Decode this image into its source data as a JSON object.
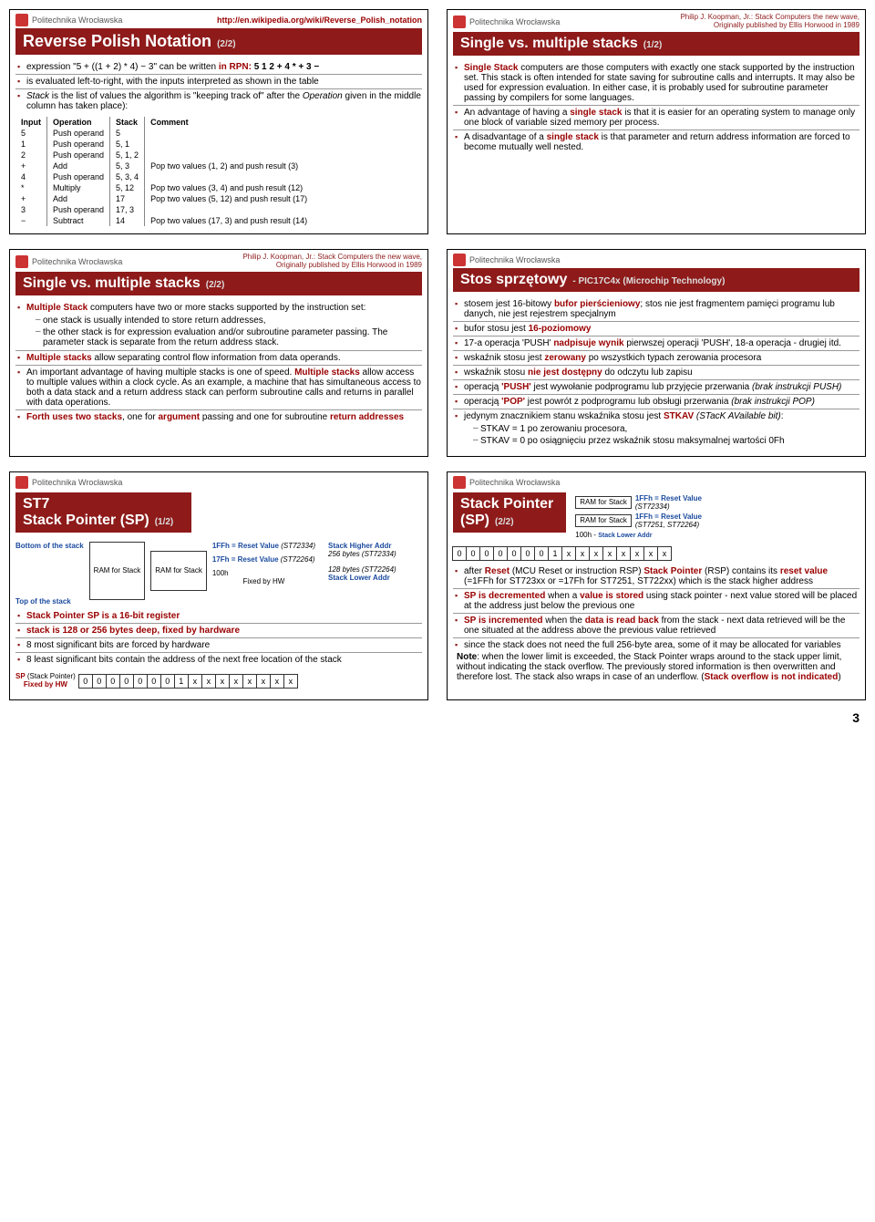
{
  "common": {
    "uni": "Politechnika Wrocławska"
  },
  "s1": {
    "srclink": "http://en.wikipedia.org/wiki/Reverse_Polish_notation",
    "title": "Reverse Polish Notation",
    "sub": "(2/2)",
    "b1a": "expression \"5 + ((1 + 2) * 4) − 3\" can be written ",
    "b1b": "in RPN:",
    "b1c": "  5 1 2 + 4 * + 3 −",
    "b2": "is evaluated left-to-right, with the inputs interpreted as shown in the table",
    "b3a": "Stack",
    "b3b": " is the list of values the algorithm is \"keeping track of\" after the ",
    "b3c": "Operation",
    "b3d": " given in the middle column has taken place):",
    "th": [
      "Input",
      "Operation",
      "Stack",
      "Comment"
    ],
    "rows": [
      [
        "5",
        "Push operand",
        "5",
        ""
      ],
      [
        "1",
        "Push operand",
        "5, 1",
        ""
      ],
      [
        "2",
        "Push operand",
        "5, 1, 2",
        ""
      ],
      [
        "+",
        "Add",
        "5, 3",
        "Pop two values (1, 2) and push result (3)"
      ],
      [
        "4",
        "Push operand",
        "5, 3, 4",
        ""
      ],
      [
        "*",
        "Multiply",
        "5, 12",
        "Pop two values (3, 4) and push result (12)"
      ],
      [
        "+",
        "Add",
        "17",
        "Pop two values (5, 12) and push result (17)"
      ],
      [
        "3",
        "Push operand",
        "17, 3",
        ""
      ],
      [
        "−",
        "Subtract",
        "14",
        "Pop two values (17, 3) and push result (14)"
      ]
    ]
  },
  "s2": {
    "fn1": "Philip J. Koopman, Jr.: Stack Computers the new wave,",
    "fn2": "Originally published by Ellis Horwood in 1989",
    "title": "Single vs. multiple stacks",
    "sub": "(1/2)",
    "b1": "Single Stack computers are those computers with exactly one stack supported by the instruction set. This stack is often intended for state saving for subroutine calls and interrupts. It may also be used for expression evaluation. In either case, it is probably used for subroutine parameter passing by compilers for some languages.",
    "b2": "An advantage of having a single stack is that it is easier for an operating system to manage only one block of variable sized memory per process.",
    "b3": "A disadvantage of a single stack is that parameter and return address information are forced to become mutually well nested."
  },
  "s3": {
    "fn1": "Philip J. Koopman, Jr.: Stack Computers the new wave,",
    "fn2": "Originally published by Ellis Horwood in 1989",
    "title": "Single vs. multiple stacks",
    "sub": "(2/2)",
    "b1": "Multiple Stack computers have two or more stacks supported by the instruction set:",
    "b1s1": "one stack is usually intended to store return addresses,",
    "b1s2": "the other stack is for expression evaluation and/or subroutine parameter passing. The parameter stack is separate from the return address stack.",
    "b2": "Multiple stacks allow separating control flow information from data operands.",
    "b3": "An important advantage of having multiple stacks is one of speed. Multiple stacks allow access to multiple values within a clock cycle. As an example, a machine that has simultaneous access to both a data stack and a return address stack can perform subroutine calls and returns in parallel with data operations.",
    "b4": "Forth uses two stacks, one for argument passing and one for subroutine return addresses"
  },
  "s4": {
    "title": "Stos sprzętowy",
    "sub": "- PIC17C4x (Microchip Technology)",
    "b1": "stosem jest 16-bitowy bufor pierścieniowy; stos nie jest fragmentem pamięci programu lub danych, nie jest rejestrem specjalnym",
    "b2": "bufor stosu jest 16-poziomowy",
    "b3": "17-a operacja 'PUSH' nadpisuje wynik pierwszej operacji 'PUSH', 18-a operacja - drugiej itd.",
    "b4": "wskaźnik stosu jest zerowany po wszystkich typach zerowania procesora",
    "b5": "wskaźnik stosu nie jest dostępny do odczytu lub zapisu",
    "b6a": "operacją ",
    "b6b": "'PUSH'",
    "b6c": " jest wywołanie podprogramu lub przyjęcie przerwania ",
    "b6d": "(brak instrukcji PUSH)",
    "b7a": "operacją ",
    "b7b": "'POP'",
    "b7c": " jest powrót z podprogramu lub obsługi przerwania ",
    "b7d": "(brak instrukcji POP)",
    "b8": "jedynym znacznikiem stanu wskaźnika stosu jest STKAV (STacK AVailable bit):",
    "b8s1": "STKAV = 1 po zerowaniu procesora,",
    "b8s2": "STKAV = 0 po osiągnięciu przez wskaźnik stosu maksymalnej wartości 0Fh"
  },
  "s5": {
    "titleA": "ST7",
    "titleB": "Stack Pointer (SP)",
    "sub": "(1/2)",
    "bottom": "Bottom of the stack",
    "top": "Top of the stack",
    "ram": "RAM for Stack",
    "rv1": "1FFh = Reset Value",
    "rv1s": "(ST72334)",
    "rv2": "17Fh = Reset Value",
    "rv2s": "(ST72264)",
    "h100": "100h",
    "fixed": "Fixed by HW",
    "hi": "Stack Higher Addr",
    "lo": "Stack Lower Addr",
    "bytes1": "256 bytes (ST72334)",
    "bytes2": "128 bytes (ST72264)",
    "bul1": "Stack Pointer SP is a 16-bit register",
    "bul2": "stack is 128 or 256 bytes deep, fixed by hardware",
    "bul3": "8 most significant bits are forced by hardware",
    "bul4": "8 least significant bits contain the address of the next free location of the stack",
    "splabel": "SP (Stack Pointer) Fixed by HW",
    "bits": [
      "0",
      "0",
      "0",
      "0",
      "0",
      "0",
      "0",
      "1",
      "x",
      "x",
      "x",
      "x",
      "x",
      "x",
      "x",
      "x"
    ]
  },
  "s6": {
    "title": "Stack Pointer (SP)",
    "sub": "(2/2)",
    "ram": "RAM for Stack",
    "rv1": "1FFh = Reset Value",
    "rv1s": "(ST72334)",
    "rv2": "1FFh = Reset Value",
    "rv2s": "(ST7251, ST72264)",
    "h100": "100h -",
    "lo": "Stack Lower Addr",
    "bits": [
      "0",
      "0",
      "0",
      "0",
      "0",
      "0",
      "0",
      "1",
      "x",
      "x",
      "x",
      "x",
      "x",
      "x",
      "x",
      "x"
    ],
    "b1": "after Reset (MCU Reset or instruction RSP) Stack Pointer (RSP) contains its reset value (=1FFh for ST723xx or =17Fh for ST7251, ST722xx) which is the stack higher address",
    "b2": "SP is decremented when a value is stored using stack pointer - next value stored will be placed at the address just below the previous one",
    "b3": "SP is incremented when the data is read back from the stack - next data retrieved will be the one situated at the address above the previous value retrieved",
    "b4": "since the stack does not need the full 256-byte area, some of it may be allocated for variables",
    "note": "Note: when the lower limit is exceeded, the Stack Pointer wraps around to the stack upper limit, without indicating the stack overflow. The previously stored information is then overwritten and therefore lost. The stack also wraps in case of an underflow. (Stack overflow is not indicated)"
  },
  "page": "3"
}
